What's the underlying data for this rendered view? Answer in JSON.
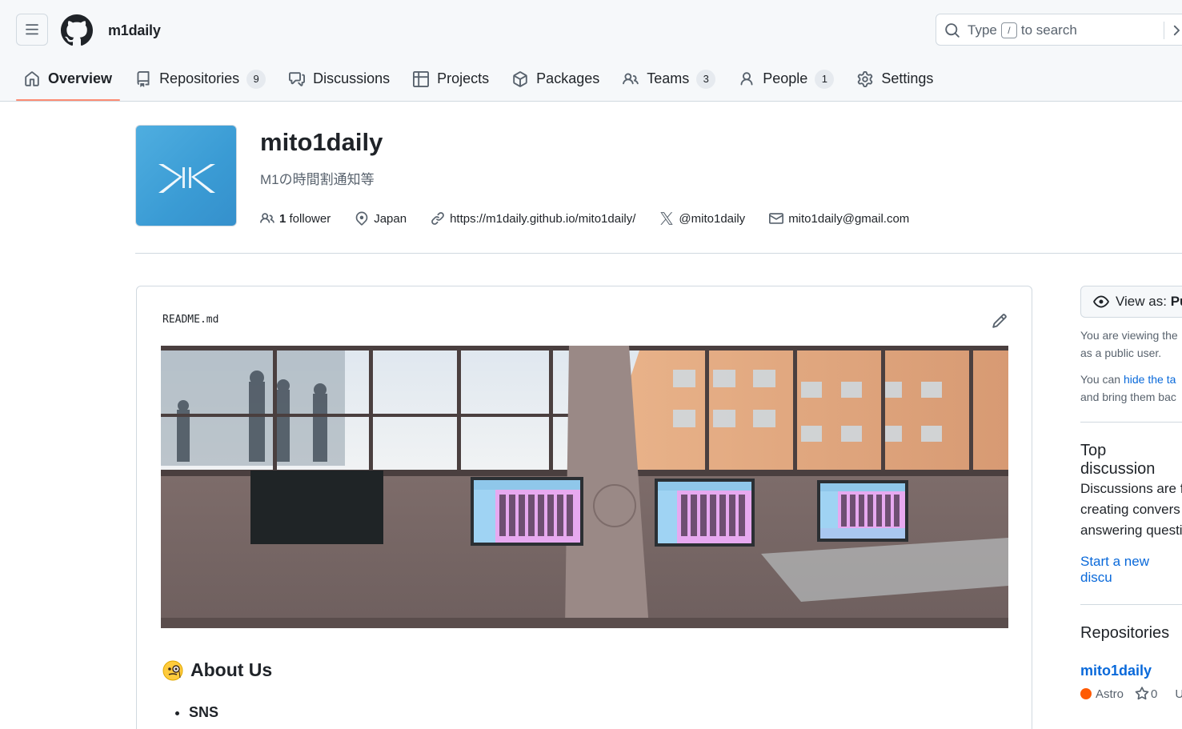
{
  "header": {
    "org_handle": "m1daily",
    "search": {
      "prefix": "Type",
      "key": "/",
      "suffix": "to search"
    }
  },
  "tabs": [
    {
      "label": "Overview",
      "count": null
    },
    {
      "label": "Repositories",
      "count": "9"
    },
    {
      "label": "Discussions",
      "count": null
    },
    {
      "label": "Projects",
      "count": null
    },
    {
      "label": "Packages",
      "count": null
    },
    {
      "label": "Teams",
      "count": "3"
    },
    {
      "label": "People",
      "count": "1"
    },
    {
      "label": "Settings",
      "count": null
    }
  ],
  "profile": {
    "name": "mito1daily",
    "description": "M1の時間割通知等",
    "followers_count": "1",
    "followers_label": "follower",
    "location": "Japan",
    "website": "https://m1daily.github.io/mito1daily/",
    "x_handle": "@mito1daily",
    "email": "mito1daily@gmail.com"
  },
  "readme": {
    "filename": "README.md",
    "heading": "About Us",
    "list": [
      "SNS"
    ]
  },
  "sidebar": {
    "view_as_label": "View as:",
    "view_as_value": "Pu",
    "note1": "You are viewing the",
    "note1b": "as a public user.",
    "note2_pre": "You can",
    "note2_link": "hide the ta",
    "note2b": "and bring them bac",
    "top_discussions_title": "Top discussion",
    "discussions_text_1": "Discussions are f",
    "discussions_text_2": "creating convers",
    "discussions_text_3": "answering questi",
    "start_discussion_link": "Start a new discu",
    "repositories_title": "Repositories",
    "repo": {
      "name": "mito1daily",
      "language": "Astro",
      "stars": "0",
      "extra": "U"
    }
  },
  "colors": {
    "accent_tab": "#fd8c73",
    "link": "#0969da",
    "astro": "#ff5a03"
  }
}
